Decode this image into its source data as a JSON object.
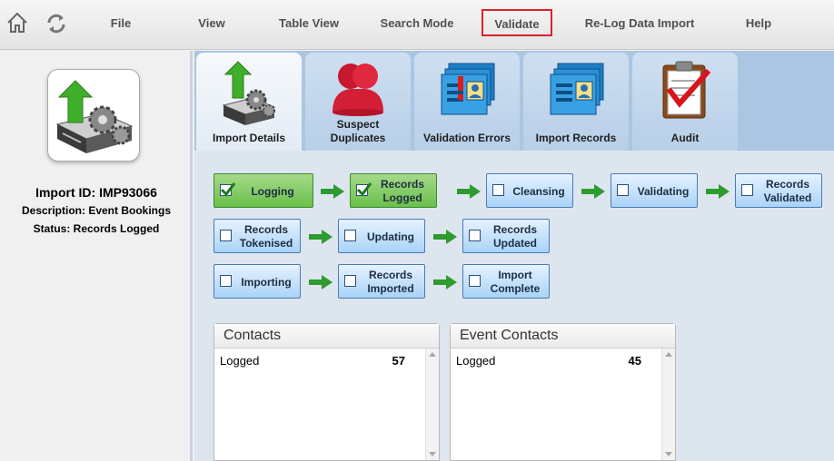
{
  "menu": {
    "home_icon": "home-icon",
    "refresh_icon": "refresh-icon",
    "items": [
      "File",
      "View",
      "Table View",
      "Search Mode",
      "Validate",
      "Re-Log Data Import",
      "Help"
    ],
    "highlighted": "Validate",
    "highlight_color": "#d9222a"
  },
  "import": {
    "icon": "import-server-icon",
    "id_line": "Import ID: IMP93066",
    "description_line": "Description: Event Bookings",
    "status_line": "Status: Records Logged"
  },
  "tabs": [
    {
      "label": "Import Details",
      "icon": "import-details-icon",
      "active": true
    },
    {
      "label": "Suspect\nDuplicates",
      "icon": "duplicates-icon",
      "active": false
    },
    {
      "label": "Validation Errors",
      "icon": "validation-errors-icon",
      "active": false
    },
    {
      "label": "Import Records",
      "icon": "import-records-icon",
      "active": false
    },
    {
      "label": "Audit",
      "icon": "audit-icon",
      "active": false
    }
  ],
  "steps": [
    {
      "label": "Logging",
      "done": true
    },
    {
      "label": "Records Logged",
      "done": true
    },
    {
      "label": "Cleansing",
      "done": false
    },
    {
      "label": "Validating",
      "done": false
    },
    {
      "label": "Records Validated",
      "done": false
    },
    {
      "label": "Records Tokenised",
      "done": false
    },
    {
      "label": "Updating",
      "done": false
    },
    {
      "label": "Records Updated",
      "done": false
    },
    {
      "label": "Importing",
      "done": false
    },
    {
      "label": "Records Imported",
      "done": false
    },
    {
      "label": "Import Complete",
      "done": false
    }
  ],
  "panels": [
    {
      "title": "Contacts",
      "row_label": "Logged",
      "row_value": "57"
    },
    {
      "title": "Event Contacts",
      "row_label": "Logged",
      "row_value": "45"
    }
  ],
  "colors": {
    "step_done": "#6ac04a",
    "step_pending": "#a9d3f7",
    "arrow": "#2f9a2f"
  }
}
